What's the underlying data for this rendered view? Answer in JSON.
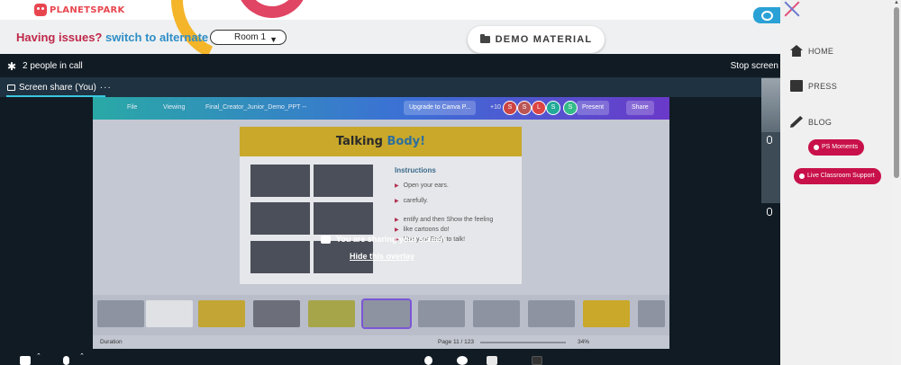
{
  "brand": {
    "name": "PLANETSPARK"
  },
  "header": {
    "issue_text": "Having issues?",
    "issue_link": "switch to alternate room",
    "room_select": "Room 1",
    "demo_button": "DEMO MATERIAL"
  },
  "call": {
    "people": "2 people in call",
    "stop_share": "Stop screen",
    "share_tab": "Screen share (You)",
    "share_more": "···"
  },
  "canva": {
    "menu_file": "File",
    "menu_viewing": "Viewing",
    "doc_title": "Final_Creator_Junior_Demo_PPT --",
    "upgrade": "Upgrade to Canva P...",
    "count": "+10",
    "avatars": [
      "S",
      "S",
      "L",
      "S",
      "S"
    ],
    "present": "Present",
    "share": "Share",
    "slide_title_1": "Talking ",
    "slide_title_2": "Body!",
    "instructions_title": "Instructions",
    "instructions": [
      "Open your ears.",
      "carefully.",
      "entify and then Show the feeling",
      "like cartoons do!",
      "Use your Body to talk!"
    ],
    "duration": "Duration",
    "page_count": "Page 11 / 123",
    "zoom": "34%"
  },
  "overlay": {
    "message": "You are sharing your screen",
    "hide_link": "Hide this overlay"
  },
  "menu": {
    "items": [
      "HOME",
      "PRESS",
      "BLOG"
    ],
    "pills": [
      "PS Moments",
      "Live Classroom Support"
    ]
  },
  "colors": {
    "accent_red": "#c8104a",
    "accent_blue": "#2f8ec6",
    "call_bg": "#111b24"
  }
}
